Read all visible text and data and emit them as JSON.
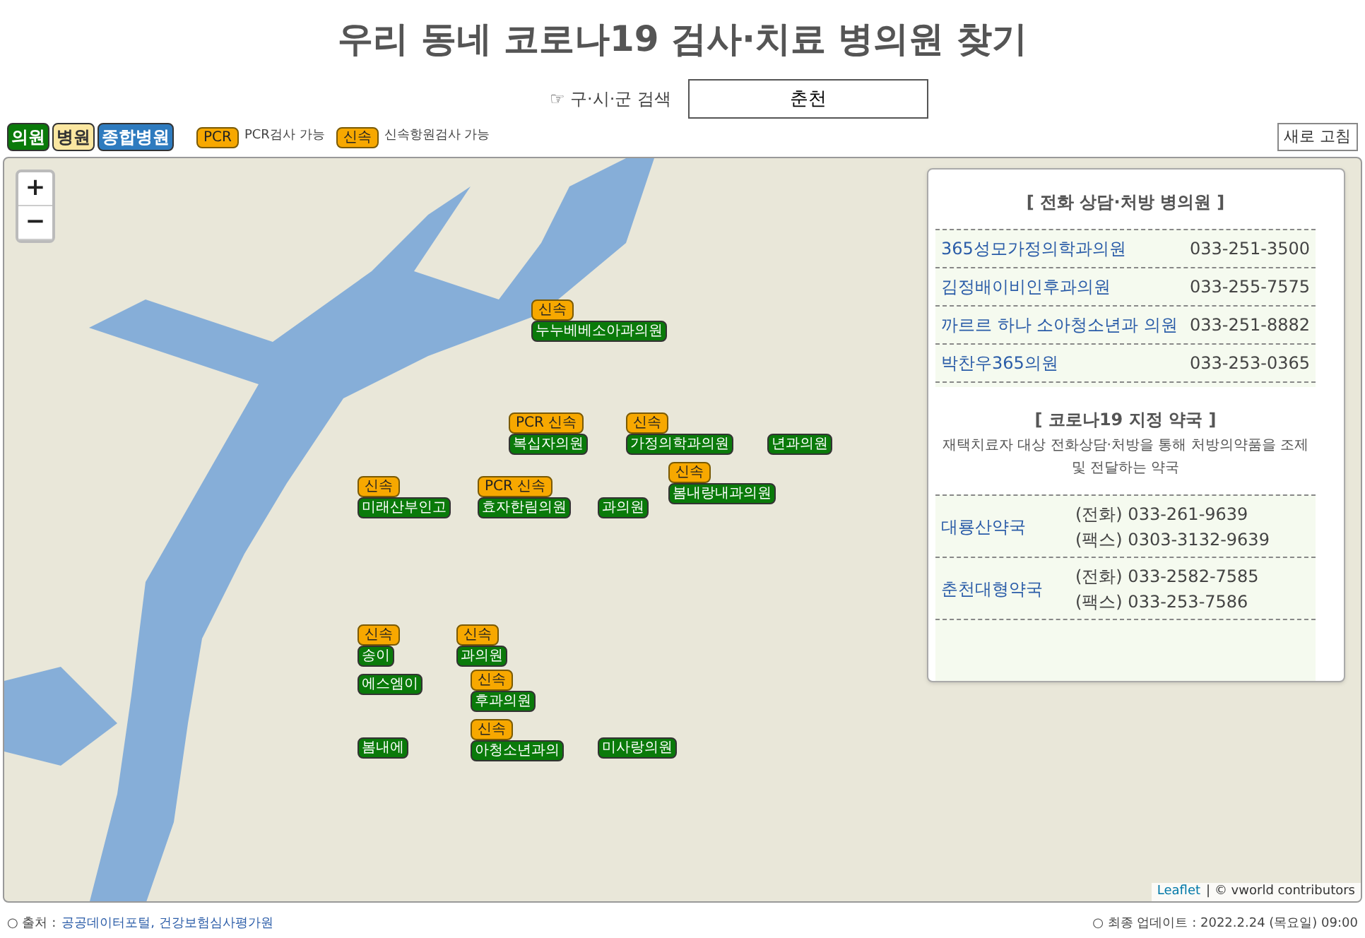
{
  "title": "우리 동네 코로나19 검사·치료 병의원 찾기",
  "search": {
    "label": "☞ 구·시·군 검색",
    "value": "춘천"
  },
  "legend": [
    {
      "label": "의원",
      "kind": "clinic"
    },
    {
      "label": "병원",
      "kind": "hospital"
    },
    {
      "label": "종합병원",
      "kind": "general"
    }
  ],
  "test_legend": [
    {
      "badge": "PCR",
      "label": "PCR검사 가능"
    },
    {
      "badge": "신속",
      "label": "신속항원검사 가능"
    }
  ],
  "refresh_button": "새로 고침",
  "zoom": [
    "+",
    "−"
  ],
  "markers": [
    {
      "badges": [
        "신속"
      ],
      "name": "누누베베소아과의원"
    },
    {
      "badges": [
        "PCR 신속"
      ],
      "name": "복십자의원"
    },
    {
      "badges": [
        "신속"
      ],
      "name": "미래산부인고"
    },
    {
      "badges": [
        "PCR 신속"
      ],
      "name": "효자한림의원"
    },
    {
      "name": "과의원"
    },
    {
      "badges": [
        "신속"
      ],
      "name": "가정의학과의원"
    },
    {
      "name": "년과의원"
    },
    {
      "badges": [
        "신속"
      ],
      "name": "봄내랑내과의원"
    },
    {
      "badges": [
        "신속"
      ],
      "name": "송이"
    },
    {
      "badges": [
        "신속"
      ],
      "name": "과의원"
    },
    {
      "name": "에스엠이"
    },
    {
      "badges": [
        "신속"
      ],
      "name": "후과의원"
    },
    {
      "name": "봄내에"
    },
    {
      "badges": [
        "신속"
      ],
      "name": "아청소년과의"
    },
    {
      "name": "미사랑의원"
    }
  ],
  "attribution": {
    "link": "Leaflet",
    "text": "| © vworld contributors"
  },
  "clinics_panel": {
    "title": "[ 전화 상담·처방 병의원 ]",
    "rows": [
      {
        "name": "365성모가정의학과의원",
        "phone": "033-251-3500"
      },
      {
        "name": "김정배이비인후과의원",
        "phone": "033-255-7575"
      },
      {
        "name": "까르르 하나 소아청소년과 의원",
        "phone": "033-251-8882"
      },
      {
        "name": "박찬우365의원",
        "phone": "033-253-0365"
      }
    ]
  },
  "pharmacy_panel": {
    "title": "[ 코로나19 지정 약국 ]",
    "description": "재택치료자 대상 전화상담·처방을 통해 처방의약품을 조제 및 전달하는 약국",
    "rows": [
      {
        "name": "대룡산약국",
        "phone": "(전화) 033-261-9639",
        "fax": "(팩스) 0303-3132-9639"
      },
      {
        "name": "춘천대형약국",
        "phone": "(전화) 033-2582-7585",
        "fax": "(팩스) 033-253-7586"
      }
    ]
  },
  "footer": {
    "source_label": "○ 출처 :",
    "source_links": "공공데이터포털, 건강보험심사평가원",
    "updated": "○ 최종 업데이트 : 2022.2.24 (목요일) 09:00"
  }
}
